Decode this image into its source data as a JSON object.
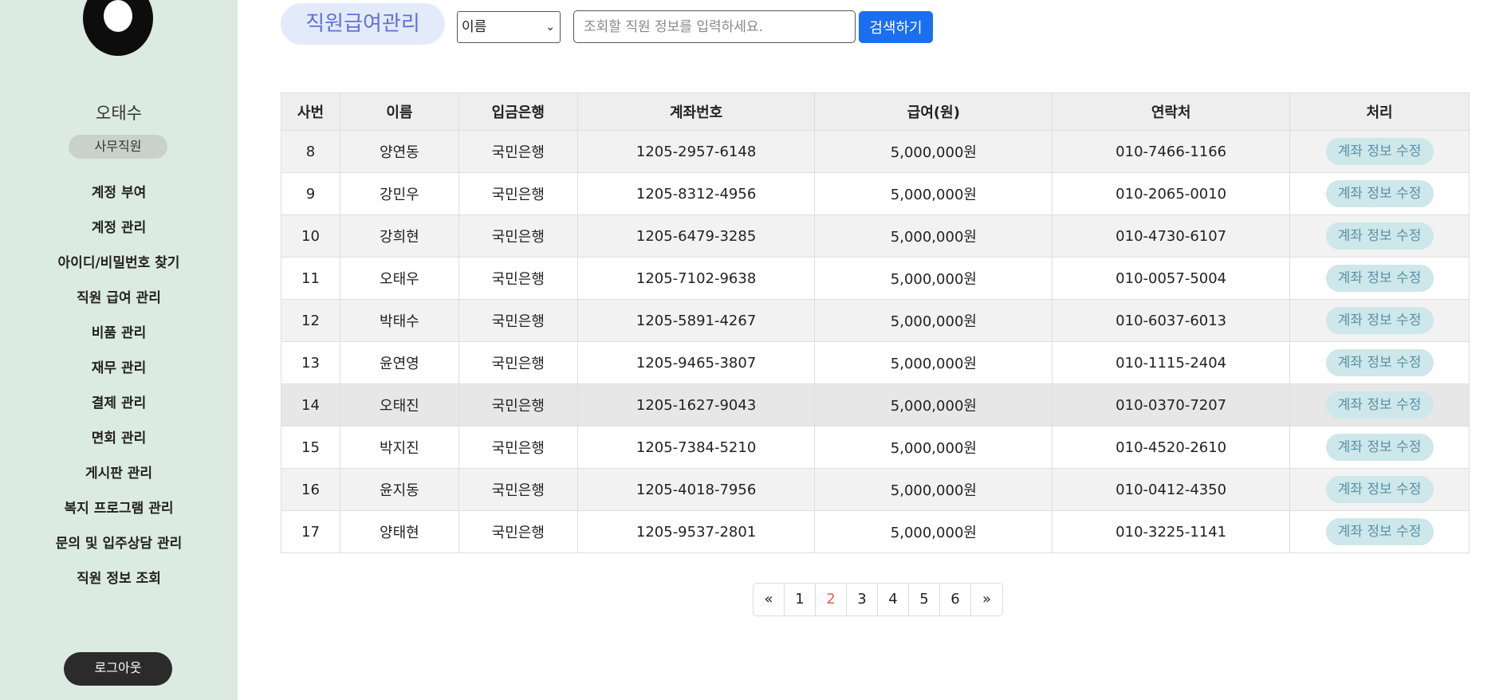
{
  "sidebar": {
    "user_name": "오태수",
    "role": "사무직원",
    "items": [
      {
        "label": "계정 부여"
      },
      {
        "label": "계정 관리"
      },
      {
        "label": "아이디/비밀번호 찾기"
      },
      {
        "label": "직원 급여 관리"
      },
      {
        "label": "비품 관리"
      },
      {
        "label": "재무 관리"
      },
      {
        "label": "결제 관리"
      },
      {
        "label": "면회 관리"
      },
      {
        "label": "게시판 관리"
      },
      {
        "label": "복지 프로그램 관리"
      },
      {
        "label": "문의 및 입주상담 관리"
      },
      {
        "label": "직원 정보 조회"
      }
    ],
    "logout_label": "로그아웃"
  },
  "toolbar": {
    "title": "직원급여관리",
    "select_value": "이름",
    "search_placeholder": "조회할 직원 정보를 입력하세요.",
    "search_label": "검색하기"
  },
  "table": {
    "headers": [
      "사번",
      "이름",
      "입금은행",
      "계좌번호",
      "급여(원)",
      "연락처",
      "처리"
    ],
    "action_label": "계좌 정보 수정",
    "rows": [
      {
        "id": "8",
        "name": "양연동",
        "bank": "국민은행",
        "account": "1205-2957-6148",
        "salary": "5,000,000원",
        "phone": "010-7466-1166"
      },
      {
        "id": "9",
        "name": "강민우",
        "bank": "국민은행",
        "account": "1205-8312-4956",
        "salary": "5,000,000원",
        "phone": "010-2065-0010"
      },
      {
        "id": "10",
        "name": "강희현",
        "bank": "국민은행",
        "account": "1205-6479-3285",
        "salary": "5,000,000원",
        "phone": "010-4730-6107"
      },
      {
        "id": "11",
        "name": "오태우",
        "bank": "국민은행",
        "account": "1205-7102-9638",
        "salary": "5,000,000원",
        "phone": "010-0057-5004"
      },
      {
        "id": "12",
        "name": "박태수",
        "bank": "국민은행",
        "account": "1205-5891-4267",
        "salary": "5,000,000원",
        "phone": "010-6037-6013"
      },
      {
        "id": "13",
        "name": "윤연영",
        "bank": "국민은행",
        "account": "1205-9465-3807",
        "salary": "5,000,000원",
        "phone": "010-1115-2404"
      },
      {
        "id": "14",
        "name": "오태진",
        "bank": "국민은행",
        "account": "1205-1627-9043",
        "salary": "5,000,000원",
        "phone": "010-0370-7207"
      },
      {
        "id": "15",
        "name": "박지진",
        "bank": "국민은행",
        "account": "1205-7384-5210",
        "salary": "5,000,000원",
        "phone": "010-4520-2610"
      },
      {
        "id": "16",
        "name": "윤지동",
        "bank": "국민은행",
        "account": "1205-4018-7956",
        "salary": "5,000,000원",
        "phone": "010-0412-4350"
      },
      {
        "id": "17",
        "name": "양태현",
        "bank": "국민은행",
        "account": "1205-9537-2801",
        "salary": "5,000,000원",
        "phone": "010-3225-1141"
      }
    ]
  },
  "pagination": {
    "prev": "«",
    "next": "»",
    "pages": [
      "1",
      "2",
      "3",
      "4",
      "5",
      "6"
    ],
    "current": "2"
  }
}
